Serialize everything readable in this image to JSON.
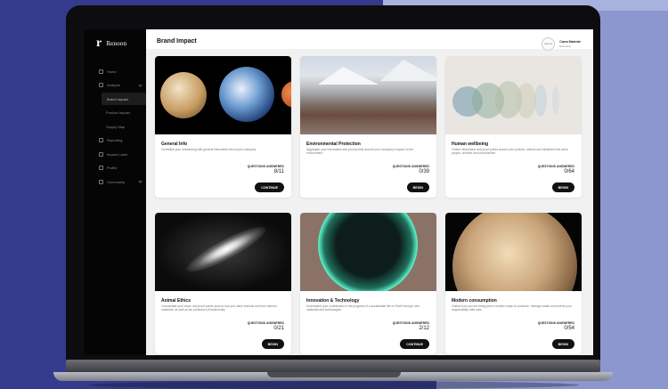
{
  "app": {
    "logo_mark": "r",
    "logo_text": "Renoon"
  },
  "sidebar": {
    "items": [
      {
        "label": "Home"
      },
      {
        "label": "Analysis"
      },
      {
        "label": "Brand Impact"
      },
      {
        "label": "Product Impact"
      },
      {
        "label": "Supply Map"
      },
      {
        "label": "Reporting"
      },
      {
        "label": "Impact Label"
      },
      {
        "label": "Profile"
      },
      {
        "label": "Community"
      }
    ]
  },
  "header": {
    "title": "Brand Impact",
    "user_name": "Carra Malente",
    "user_role": "Executive",
    "avatar_text": "RENOON"
  },
  "cards": [
    {
      "title": "General Info",
      "description": "Centralize your onboarding with general information about your company",
      "q_label": "QUESTIONS ANSWERED",
      "q_count": "8/11",
      "button": "CONTINUE"
    },
    {
      "title": "Environmental Protection",
      "description": "Aggregate your information and proof points around your company's impact on the environment",
      "q_label": "QUESTIONS ANSWERED",
      "q_count": "0/39",
      "button": "BEGIN"
    },
    {
      "title": "Human wellbeing",
      "description": "Collect information and proof points around your policies, actions and initiatives that value people, workers and communities",
      "q_label": "QUESTIONS ANSWERED",
      "q_count": "0/64",
      "button": "BEGIN"
    },
    {
      "title": "Animal Ethics",
      "description": "Consolidate your vision and proof points around how you value animals and their derived materials, as well as the protection of biodiversity",
      "q_label": "QUESTIONS ANSWERED",
      "q_count": "0/21",
      "button": "BEGIN"
    },
    {
      "title": "Innovation & Technology",
      "description": "Understand your contribution to the progress of a sustainable life on Earth through new materials and technologies",
      "q_label": "QUESTIONS ANSWERED",
      "q_count": "2/12",
      "button": "CONTINUE"
    },
    {
      "title": "Modern consumption",
      "description": "Outline how you are being part in modern ways to consume, manage waste and extend your responsibility after sale",
      "q_label": "QUESTIONS ANSWERED",
      "q_count": "0/54",
      "button": "BEGIN"
    }
  ],
  "colors": {
    "background": "#353b8c",
    "panel": "#f1f1f1",
    "accent": "#111111"
  }
}
